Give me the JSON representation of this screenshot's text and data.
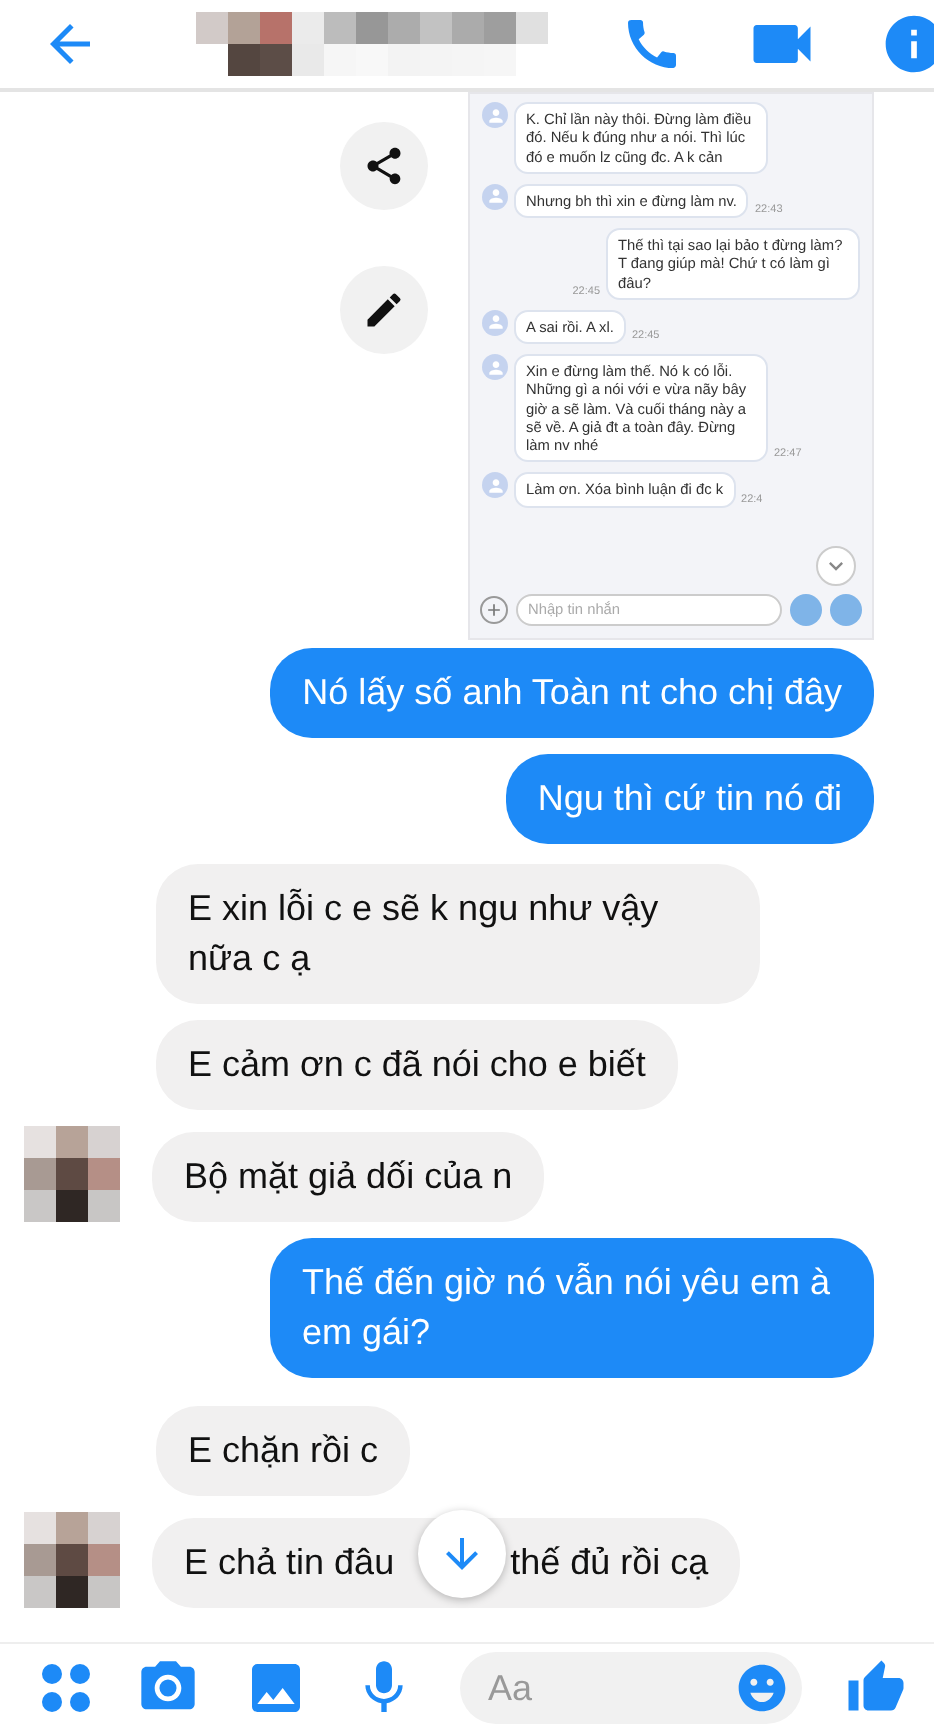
{
  "shared_screenshot": {
    "messages": [
      {
        "kind": "incoming",
        "text": "K. Chỉ lần này thôi. Đừng làm điều đó. Nếu k đúng như a nói. Thì lúc đó e muốn lz cũng đc. A k cản"
      },
      {
        "kind": "incoming",
        "text": "Nhưng bh thì xin e đừng làm nv.",
        "time": "22:43"
      },
      {
        "kind": "outgoing",
        "text": "Thế thì tại sao lại bảo t đừng làm? T đang giúp mà! Chứ t có làm gì đâu?",
        "time": "22:45"
      },
      {
        "kind": "incoming",
        "text": "A sai rồi. A xl.",
        "time": "22:45"
      },
      {
        "kind": "incoming",
        "text": "Xin e đừng làm thế. Nó k có lỗi. Những gì a nói với e vừa nãy bây giờ a sẽ làm. Và cuối tháng này a sẽ về. A giả đt a toàn đây. Đừng làm nv nhé",
        "time": "22:47"
      },
      {
        "kind": "incoming",
        "text": "Làm ơn. Xóa bình luận đi đc k",
        "time": "22:4"
      }
    ],
    "composer": {
      "placeholder": "Nhập tin nhắn"
    }
  },
  "messages": [
    {
      "kind": "outgoing",
      "text": "Nó lấy số anh Toàn nt cho chị đây"
    },
    {
      "kind": "outgoing",
      "text": "Ngu thì cứ tin nó đi"
    },
    {
      "kind": "incoming",
      "text": "E xin lỗi c e sẽ k ngu như vậy nữa c ạ",
      "avatar": false
    },
    {
      "kind": "incoming",
      "text": "E cảm ơn c đã nói cho e biết",
      "avatar": false
    },
    {
      "kind": "incoming",
      "text": "Bộ mặt giả dối của n",
      "avatar": true
    },
    {
      "kind": "outgoing",
      "text": "Thế đến giờ nó vẫn nói yêu em à em gái?"
    },
    {
      "kind": "incoming",
      "text": "E chặn rồi c",
      "avatar": false
    },
    {
      "kind": "incoming",
      "parts": [
        "E chả tin đâu",
        "thế đủ rồi cạ"
      ],
      "avatar": true
    }
  ],
  "composer": {
    "placeholder": "Aa"
  }
}
